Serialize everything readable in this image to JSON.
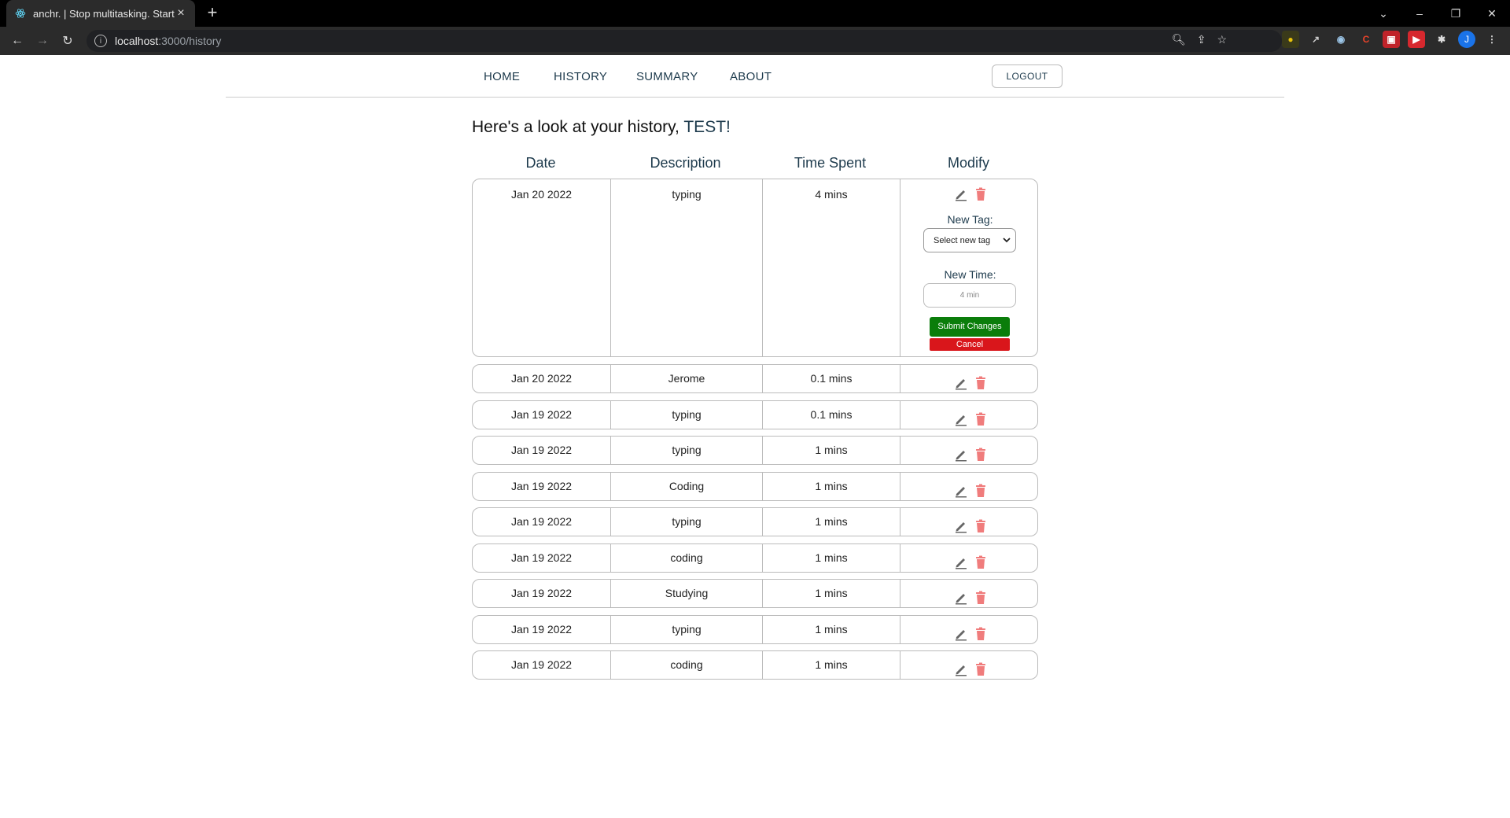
{
  "browser": {
    "tab_title": "anchr. | Stop multitasking. Start f",
    "url_host": "localhost",
    "url_path": ":3000/history",
    "avatar_initial": "J"
  },
  "nav": {
    "home": "HOME",
    "history": "HISTORY",
    "summary": "SUMMARY",
    "about": "ABOUT",
    "logout": "LOGOUT"
  },
  "heading": {
    "prefix": "Here's a look at your history, ",
    "name": "TEST!"
  },
  "columns": [
    "Date",
    "Description",
    "Time Spent",
    "Modify"
  ],
  "edit_panel": {
    "new_tag_label": "New Tag:",
    "select_value": "Select new tag",
    "new_time_label": "New Time:",
    "time_placeholder": "4 min",
    "submit_label": "Submit Changes",
    "cancel_label": "Cancel"
  },
  "rows": [
    {
      "date": "Jan 20 2022",
      "description": "typing",
      "time": "4 mins"
    },
    {
      "date": "Jan 20 2022",
      "description": "Jerome",
      "time": "0.1 mins"
    },
    {
      "date": "Jan 19 2022",
      "description": "typing",
      "time": "0.1 mins"
    },
    {
      "date": "Jan 19 2022",
      "description": "typing",
      "time": "1 mins"
    },
    {
      "date": "Jan 19 2022",
      "description": "Coding",
      "time": "1 mins"
    },
    {
      "date": "Jan 19 2022",
      "description": "typing",
      "time": "1 mins"
    },
    {
      "date": "Jan 19 2022",
      "description": "coding",
      "time": "1 mins"
    },
    {
      "date": "Jan 19 2022",
      "description": "Studying",
      "time": "1 mins"
    },
    {
      "date": "Jan 19 2022",
      "description": "typing",
      "time": "1 mins"
    },
    {
      "date": "Jan 19 2022",
      "description": "coding",
      "time": "1 mins"
    }
  ],
  "colors": {
    "accent": "#1d3a4c",
    "submit": "#0a7d0a",
    "cancel": "#d9161b",
    "trash": "#f07c7c"
  }
}
